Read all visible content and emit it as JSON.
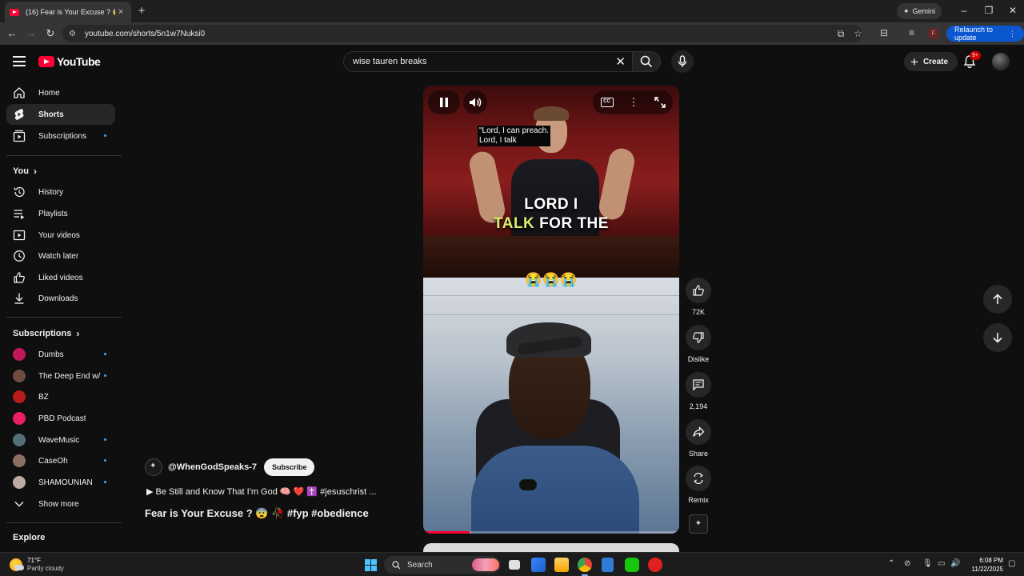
{
  "browser": {
    "tab_title": "(16) Fear is Your Excuse ? 😨 🔊",
    "tab_close": "×",
    "new_tab": "+",
    "gemini_label": "Gemini",
    "url": "youtube.com/shorts/5n1w7Nuksi0",
    "profile_initial": "F",
    "relaunch_label": "Relaunch to update"
  },
  "masthead": {
    "logo_text": "YouTube",
    "search_value": "wise tauren breaks",
    "create_label": "Create",
    "notification_count": "9+"
  },
  "sidebar": {
    "main": [
      {
        "label": "Home",
        "icon": "home-icon"
      },
      {
        "label": "Shorts",
        "icon": "shorts-icon",
        "active": true
      },
      {
        "label": "Subscriptions",
        "icon": "subscriptions-icon",
        "dot": true
      }
    ],
    "you_heading": "You",
    "you_items": [
      {
        "label": "History",
        "icon": "history-icon"
      },
      {
        "label": "Playlists",
        "icon": "playlists-icon"
      },
      {
        "label": "Your videos",
        "icon": "your-videos-icon"
      },
      {
        "label": "Watch later",
        "icon": "watch-later-icon"
      },
      {
        "label": "Liked videos",
        "icon": "liked-videos-icon"
      },
      {
        "label": "Downloads",
        "icon": "downloads-icon"
      }
    ],
    "subscriptions_heading": "Subscriptions",
    "subscriptions": [
      {
        "label": "Dumbs",
        "color": "#c2185b"
      },
      {
        "label": "The Deep End w/...",
        "color": "#6d4c41"
      },
      {
        "label": "BZ",
        "color": "#b71c1c"
      },
      {
        "label": "PBD Podcast",
        "color": "#e91e63"
      },
      {
        "label": "WaveMusic",
        "color": "#546e7a"
      },
      {
        "label": "CaseOh",
        "color": "#8d6e63"
      },
      {
        "label": "SHAMOUNIAN",
        "color": "#bcaaa4"
      }
    ],
    "show_more": "Show more",
    "explore_heading": "Explore"
  },
  "short": {
    "channel": "@WhenGodSpeaks-7",
    "subscribe_label": "Subscribe",
    "description": "▶ Be Still and Know That I'm God 🧠 ❤️ ✝️  #jesuschrist ...",
    "title": "Fear is Your Excuse ? 😨 🥀  #fyp #obedience",
    "caption_line1": "\"Lord, I can preach.",
    "caption_line2": "Lord, I talk",
    "burn_line1": "LORD I",
    "burn_line2_highlight": "TALK",
    "burn_line2_rest": "FOR THE",
    "emojis": "😭😭😭",
    "cc_label": "CC",
    "progress": 0.18
  },
  "actions": {
    "likes": "72K",
    "dislike_label": "Dislike",
    "comments": "2,194",
    "share_label": "Share",
    "remix_label": "Remix"
  },
  "taskbar": {
    "temperature": "71°F",
    "weather": "Partly cloudy",
    "search_label": "Search",
    "time": "6:08 PM",
    "date": "11/22/2025"
  }
}
